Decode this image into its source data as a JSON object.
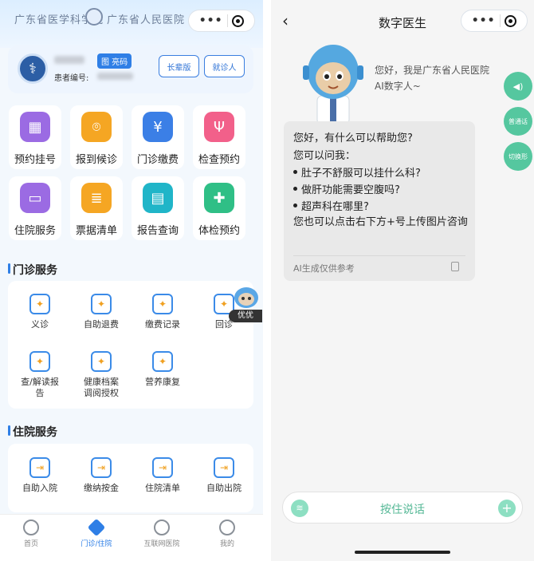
{
  "left": {
    "hospital_name_1": "广东省医学科学院",
    "hospital_name_2": "广东省人民医院",
    "patient": {
      "qr_label": "图 亮码",
      "id_label": "患者编号:",
      "elder_label": "长辈版",
      "visit_label": "就诊人"
    },
    "quick": [
      {
        "label": "预约挂号",
        "icon": "calendar-icon",
        "color": "#9b6be3"
      },
      {
        "label": "报到候诊",
        "icon": "location-pin-icon",
        "color": "#f5a623"
      },
      {
        "label": "门诊缴费",
        "icon": "payment-icon",
        "color": "#3b7fe6"
      },
      {
        "label": "检查预约",
        "icon": "stethoscope-icon",
        "color": "#f2608a"
      },
      {
        "label": "住院服务",
        "icon": "bed-icon",
        "color": "#9b6be3"
      },
      {
        "label": "票据清单",
        "icon": "receipt-icon",
        "color": "#f5a623"
      },
      {
        "label": "报告查询",
        "icon": "report-icon",
        "color": "#20b5c8"
      },
      {
        "label": "体检预约",
        "icon": "checkup-icon",
        "color": "#2fbf86"
      }
    ],
    "outpatient": {
      "title": "门诊服务",
      "items": [
        {
          "label": "义诊",
          "icon": "free-clinic-icon"
        },
        {
          "label": "自助退费",
          "icon": "refund-icon"
        },
        {
          "label": "缴费记录",
          "icon": "payment-record-icon"
        },
        {
          "label": "回诊",
          "icon": "return-visit-icon"
        },
        {
          "label": "查/解读报告",
          "icon": "read-report-icon"
        },
        {
          "label": "健康档案调阅授权",
          "icon": "health-record-icon"
        },
        {
          "label": "营养康复",
          "icon": "nutrition-icon"
        }
      ],
      "float_label": "优优"
    },
    "inpatient": {
      "title": "住院服务",
      "items": [
        {
          "label": "自助入院",
          "icon": "admission-icon"
        },
        {
          "label": "缴纳按金",
          "icon": "deposit-icon"
        },
        {
          "label": "住院清单",
          "icon": "inpatient-list-icon"
        },
        {
          "label": "自助出院",
          "icon": "discharge-icon"
        }
      ]
    },
    "tabs": [
      {
        "label": "首页",
        "icon": "home-icon",
        "active": false
      },
      {
        "label": "门诊/住院",
        "icon": "outpatient-icon",
        "active": true
      },
      {
        "label": "互联网医院",
        "icon": "internet-hospital-icon",
        "active": false
      },
      {
        "label": "我的",
        "icon": "profile-icon",
        "active": false
      }
    ],
    "accent": "#2f7fe6"
  },
  "right": {
    "title": "数字医生",
    "greeting": "您好，我是广东省人民医院AI数字人~",
    "message": {
      "line1": "您好，有什么可以帮助您?",
      "line2": "您可以问我：",
      "bullets": [
        "肚子不舒服可以挂什么科?",
        "做肝功能需要空腹吗?",
        "超声科在哪里?"
      ],
      "line3": "您也可以点击右下方+号上传图片咨询",
      "disclaimer": "AI生成仅供参考"
    },
    "side_buttons": [
      {
        "label": "",
        "icon": "speaker-icon"
      },
      {
        "label": "普通话",
        "icon": "language-icon"
      },
      {
        "label": "切换形",
        "icon": "switch-avatar-icon"
      }
    ],
    "voice_label": "按住说话",
    "accent": "#55c79f"
  }
}
